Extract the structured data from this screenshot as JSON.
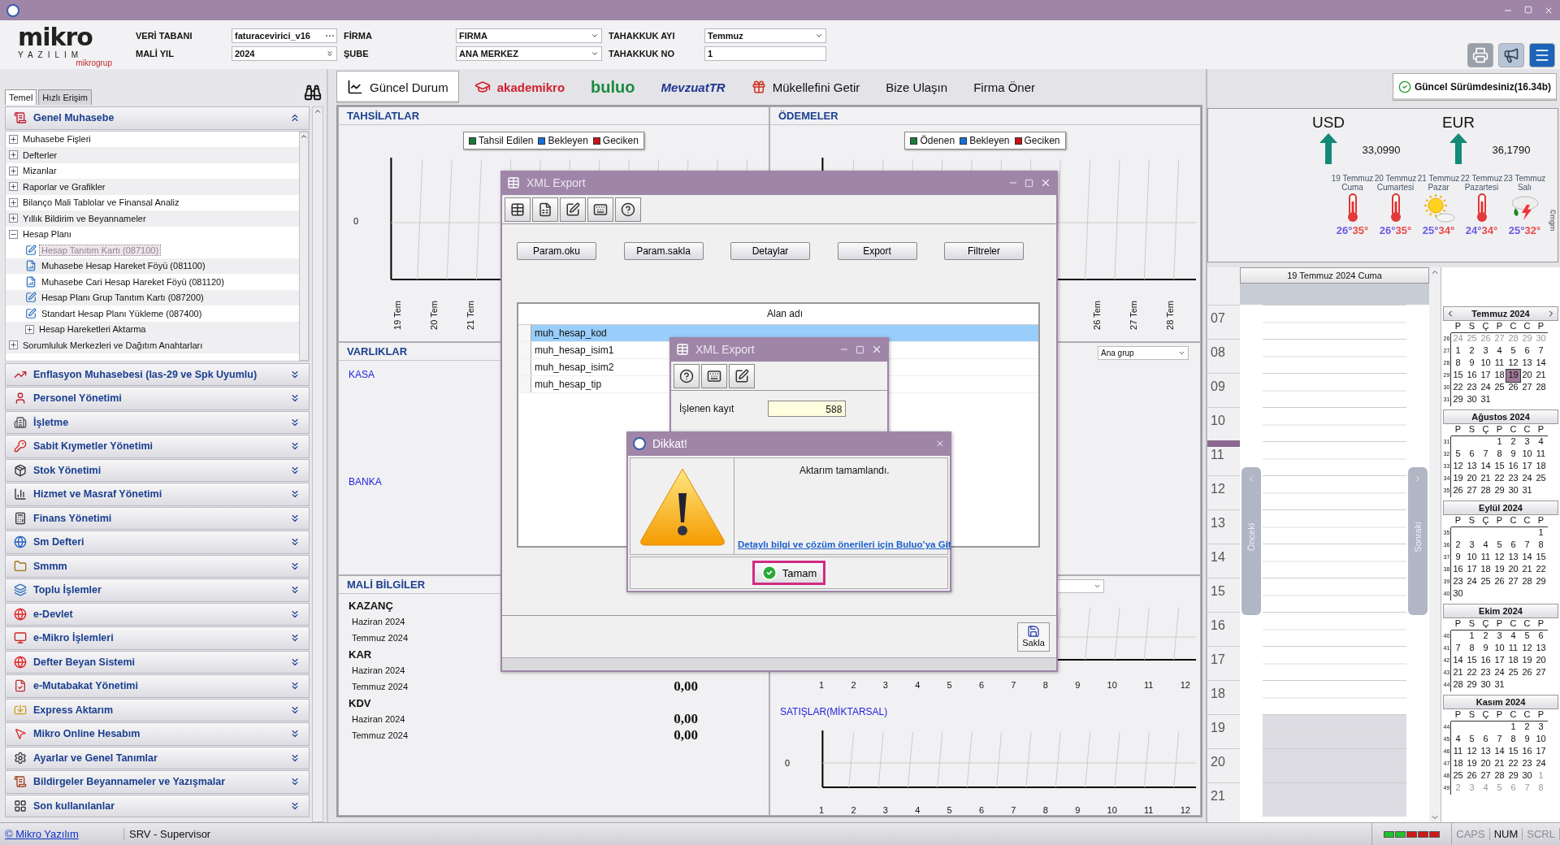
{
  "header": {
    "logo": {
      "name": "mikro",
      "sub": "YAZILIM",
      "group": "mikrogrup"
    },
    "fields": [
      {
        "label": "VERİ TABANI",
        "value": "faturacevirici_v16",
        "kind": "browse"
      },
      {
        "label": "MALİ YIL",
        "value": "2024",
        "kind": "spin"
      },
      {
        "label": "FİRMA",
        "value": "FIRMA",
        "kind": "combo"
      },
      {
        "label": "ŞUBE",
        "value": "ANA MERKEZ",
        "kind": "combo"
      },
      {
        "label": "TAHAKKUK AYI",
        "value": "Temmuz",
        "kind": "combo"
      },
      {
        "label": "TAHAKKUK NO",
        "value": "1",
        "kind": "text"
      }
    ]
  },
  "sidebar": {
    "tabs": [
      {
        "label": "Temel",
        "selected": true
      },
      {
        "label": "Hızlı Erişim",
        "selected": false
      }
    ],
    "open_section": "Genel Muhasebe",
    "tree": [
      {
        "label": "Muhasebe Fişleri",
        "kind": "group",
        "expanded": false,
        "selected": false
      },
      {
        "label": "Defterler",
        "kind": "group",
        "expanded": false,
        "selected": false
      },
      {
        "label": "Mizanlar",
        "kind": "group",
        "expanded": false,
        "selected": false
      },
      {
        "label": "Raporlar ve Grafikler",
        "kind": "group",
        "expanded": false,
        "selected": false
      },
      {
        "label": "Bilanço Mali Tablolar ve Finansal Analiz",
        "kind": "group",
        "expanded": false,
        "selected": false
      },
      {
        "label": "Yıllık Bildirim ve Beyannameler",
        "kind": "group",
        "expanded": false,
        "selected": false
      },
      {
        "label": "Hesap Planı",
        "kind": "group",
        "expanded": true,
        "selected": false,
        "children": [
          {
            "label": "Hesap Tanıtım Kartı (087100)",
            "kind": "form",
            "selected": true
          },
          {
            "label": "Muhasebe Hesap Hareket Föyü (081100)",
            "kind": "report",
            "selected": false
          },
          {
            "label": "Muhasebe Cari Hesap Hareket Föyü (081120)",
            "kind": "report",
            "selected": false
          },
          {
            "label": "Hesap Planı Grup Tanıtım Kartı (087200)",
            "kind": "form",
            "selected": false
          },
          {
            "label": "Standart Hesap Planı Yükleme (087400)",
            "kind": "form",
            "selected": false
          },
          {
            "label": "Hesap Hareketleri Aktarma",
            "kind": "group",
            "expanded": false,
            "selected": false
          }
        ]
      },
      {
        "label": "Sorumluluk Merkezleri ve Dağıtım Anahtarları",
        "kind": "group",
        "expanded": false,
        "selected": false
      }
    ],
    "sections": [
      "Enflasyon Muhasebesi (Ias-29 ve Spk Uyumlu)",
      "Personel Yönetimi",
      "İşletme",
      "Sabit Kıymetler Yönetimi",
      "Stok Yönetimi",
      "Hizmet ve Masraf Yönetimi",
      "Finans Yönetimi",
      "Sm Defteri",
      "Smmm",
      "Toplu İşlemler",
      "e-Devlet",
      "e-Mikro İşlemleri",
      "Defter Beyan Sistemi",
      "e-Mutabakat Yönetimi",
      "Express Aktarım",
      "Mikro Online Hesabım",
      "Ayarlar ve Genel Tanımlar",
      "Bildirgeler Beyannameler ve Yazışmalar",
      "Son kullanılanlar"
    ]
  },
  "tabs": [
    {
      "label": "Güncel Durum",
      "kind": "dashboard",
      "selected": true
    },
    {
      "label": "akademikro",
      "kind": "academy",
      "selected": false
    },
    {
      "label": "buluo",
      "kind": "buluo",
      "selected": false
    },
    {
      "label": "MevzuatTR",
      "kind": "mevzuat",
      "selected": false
    },
    {
      "label": "Mükellefini Getir",
      "kind": "gift",
      "selected": false
    },
    {
      "label": "Bize Ulaşın",
      "kind": "plain",
      "selected": false
    },
    {
      "label": "Firma Öner",
      "kind": "plain",
      "selected": false
    }
  ],
  "version_badge": "Güncel Sürümdesiniz(16.34b)",
  "tahsilatlar": {
    "title": "TAHSİLATLAR",
    "legend": [
      {
        "label": "Tahsil Edilen",
        "color": "#1b7a3a"
      },
      {
        "label": "Bekleyen",
        "color": "#1a6fd6"
      },
      {
        "label": "Geciken",
        "color": "#c81414"
      }
    ],
    "y_tick": "0",
    "x_labels": [
      "19 Tem",
      "20 Tem",
      "21 Tem"
    ]
  },
  "odemeler": {
    "title": "ÖDEMELER",
    "legend": [
      {
        "label": "Ödenen",
        "color": "#1b7a3a"
      },
      {
        "label": "Bekleyen",
        "color": "#1a6fd6"
      },
      {
        "label": "Geciken",
        "color": "#c81414"
      }
    ],
    "x_labels": [
      "26 Tem",
      "27 Tem",
      "28 Tem"
    ]
  },
  "varliklar": {
    "title": "VARLIKLAR",
    "items": [
      "KASA",
      "BANKA"
    ],
    "group_select": "Ana grup"
  },
  "mali_bilgiler": {
    "title": "MALİ BİLGİLER",
    "groups": [
      {
        "name": "KAZANÇ",
        "rows": [
          {
            "period": "Haziran 2024"
          },
          {
            "period": "Temmuz 2024"
          }
        ]
      },
      {
        "name": "KAR",
        "rows": [
          {
            "period": "Haziran 2024"
          },
          {
            "period": "Temmuz 2024",
            "value": "0,00"
          }
        ]
      },
      {
        "name": "KDV",
        "rows": [
          {
            "period": "Haziran 2024",
            "value": "0,00"
          },
          {
            "period": "Temmuz 2024",
            "value": "0,00"
          }
        ]
      }
    ]
  },
  "sales_charts": {
    "months": [
      "1",
      "2",
      "3",
      "4",
      "5",
      "6",
      "7",
      "8",
      "9",
      "10",
      "11",
      "12"
    ],
    "second_months": [
      "1",
      "2",
      "3",
      "4",
      "5",
      "6",
      "7",
      "8",
      "9",
      "10",
      "11",
      "12"
    ],
    "second_title": "SATIŞLAR(MİKTARSAL)",
    "second_y_tick": "0"
  },
  "currencies": [
    {
      "code": "USD",
      "rate": "33,0990"
    },
    {
      "code": "EUR",
      "rate": "36,1790"
    }
  ],
  "weather": {
    "credit": "©mgm",
    "days": [
      {
        "date": "19 Temmuz",
        "day": "Cuma",
        "kind": "hot",
        "low": "26°",
        "high": "35°"
      },
      {
        "date": "20 Temmuz",
        "day": "Cumartesi",
        "kind": "hot",
        "low": "26°",
        "high": "35°"
      },
      {
        "date": "21 Temmuz",
        "day": "Pazar",
        "kind": "sunny",
        "low": "25°",
        "high": "34°"
      },
      {
        "date": "22 Temmuz",
        "day": "Pazartesi",
        "kind": "hot",
        "low": "24°",
        "high": "34°"
      },
      {
        "date": "23 Temmuz",
        "day": "Salı",
        "kind": "storm",
        "low": "25°",
        "high": "32°"
      }
    ]
  },
  "day_view": {
    "title": "19 Temmuz 2024 Cuma",
    "prev": "Önceki",
    "next": "Sonraki",
    "hours": [
      {
        "label": "07",
        "current": false,
        "off_hours": false
      },
      {
        "label": "08",
        "current": false,
        "off_hours": false
      },
      {
        "label": "09",
        "current": false,
        "off_hours": false
      },
      {
        "label": "10",
        "current": false,
        "off_hours": false
      },
      {
        "label": "11",
        "current": true,
        "off_hours": false
      },
      {
        "label": "12",
        "current": false,
        "off_hours": false
      },
      {
        "label": "13",
        "current": false,
        "off_hours": false
      },
      {
        "label": "14",
        "current": false,
        "off_hours": false
      },
      {
        "label": "15",
        "current": false,
        "off_hours": false
      },
      {
        "label": "16",
        "current": false,
        "off_hours": false
      },
      {
        "label": "17",
        "current": false,
        "off_hours": false
      },
      {
        "label": "18",
        "current": false,
        "off_hours": false
      },
      {
        "label": "19",
        "current": false,
        "off_hours": true
      },
      {
        "label": "20",
        "current": false,
        "off_hours": true
      },
      {
        "label": "21",
        "current": false,
        "off_hours": true
      }
    ]
  },
  "calendar": {
    "months": [
      {
        "title": "Temmuz 2024",
        "weekdays": [
          "P",
          "S",
          "Ç",
          "P",
          "C",
          "C",
          "P"
        ],
        "weeks": [
          {
            "no": "26",
            "days": [
              {
                "d": "24",
                "muted": true,
                "selected": false
              },
              {
                "d": "25",
                "muted": true,
                "selected": false
              },
              {
                "d": "26",
                "muted": true,
                "selected": false
              },
              {
                "d": "27",
                "muted": true,
                "selected": false
              },
              {
                "d": "28",
                "muted": true,
                "selected": false
              },
              {
                "d": "29",
                "muted": true,
                "selected": false
              },
              {
                "d": "30",
                "muted": true,
                "selected": false
              }
            ]
          },
          {
            "no": "27",
            "days": [
              {
                "d": "1",
                "muted": false,
                "selected": false
              },
              {
                "d": "2",
                "muted": false,
                "selected": false
              },
              {
                "d": "3",
                "muted": false,
                "selected": false
              },
              {
                "d": "4",
                "muted": false,
                "selected": false
              },
              {
                "d": "5",
                "muted": false,
                "selected": false
              },
              {
                "d": "6",
                "muted": false,
                "selected": false
              },
              {
                "d": "7",
                "muted": false,
                "selected": false
              }
            ]
          },
          {
            "no": "28",
            "days": [
              {
                "d": "8",
                "muted": false,
                "selected": false
              },
              {
                "d": "9",
                "muted": false,
                "selected": false
              },
              {
                "d": "10",
                "muted": false,
                "selected": false
              },
              {
                "d": "11",
                "muted": false,
                "selected": false
              },
              {
                "d": "12",
                "muted": false,
                "selected": false
              },
              {
                "d": "13",
                "muted": false,
                "selected": false
              },
              {
                "d": "14",
                "muted": false,
                "selected": false
              }
            ]
          },
          {
            "no": "29",
            "days": [
              {
                "d": "15",
                "muted": false,
                "selected": false
              },
              {
                "d": "16",
                "muted": false,
                "selected": false
              },
              {
                "d": "17",
                "muted": false,
                "selected": false
              },
              {
                "d": "18",
                "muted": false,
                "selected": false
              },
              {
                "d": "19",
                "muted": false,
                "selected": true
              },
              {
                "d": "20",
                "muted": false,
                "selected": false
              },
              {
                "d": "21",
                "muted": false,
                "selected": false
              }
            ]
          },
          {
            "no": "30",
            "days": [
              {
                "d": "22",
                "muted": false,
                "selected": false
              },
              {
                "d": "23",
                "muted": false,
                "selected": false
              },
              {
                "d": "24",
                "muted": false,
                "selected": false
              },
              {
                "d": "25",
                "muted": false,
                "selected": false
              },
              {
                "d": "26",
                "muted": false,
                "selected": false
              },
              {
                "d": "27",
                "muted": false,
                "selected": false
              },
              {
                "d": "28",
                "muted": false,
                "selected": false
              }
            ]
          },
          {
            "no": "31",
            "days": [
              {
                "d": "29",
                "muted": false,
                "selected": false
              },
              {
                "d": "30",
                "muted": false,
                "selected": false
              },
              {
                "d": "31",
                "muted": false,
                "selected": false
              }
            ]
          }
        ]
      },
      {
        "title": "Ağustos 2024",
        "weekdays": [
          "P",
          "S",
          "Ç",
          "P",
          "C",
          "C",
          "P"
        ],
        "weeks": [
          {
            "no": "31",
            "days": [
              {
                "d": "1",
                "muted": false,
                "selected": false
              },
              {
                "d": "2",
                "muted": false,
                "selected": false
              },
              {
                "d": "3",
                "muted": false,
                "selected": false
              },
              {
                "d": "4",
                "muted": false,
                "selected": false
              }
            ]
          },
          {
            "no": "32",
            "days": [
              {
                "d": "5",
                "muted": false,
                "selected": false
              },
              {
                "d": "6",
                "muted": false,
                "selected": false
              },
              {
                "d": "7",
                "muted": false,
                "selected": false
              },
              {
                "d": "8",
                "muted": false,
                "selected": false
              },
              {
                "d": "9",
                "muted": false,
                "selected": false
              },
              {
                "d": "10",
                "muted": false,
                "selected": false
              },
              {
                "d": "11",
                "muted": false,
                "selected": false
              }
            ]
          },
          {
            "no": "33",
            "days": [
              {
                "d": "12",
                "muted": false,
                "selected": false
              },
              {
                "d": "13",
                "muted": false,
                "selected": false
              },
              {
                "d": "14",
                "muted": false,
                "selected": false
              },
              {
                "d": "15",
                "muted": false,
                "selected": false
              },
              {
                "d": "16",
                "muted": false,
                "selected": false
              },
              {
                "d": "17",
                "muted": false,
                "selected": false
              },
              {
                "d": "18",
                "muted": false,
                "selected": false
              }
            ]
          },
          {
            "no": "34",
            "days": [
              {
                "d": "19",
                "muted": false,
                "selected": false
              },
              {
                "d": "20",
                "muted": false,
                "selected": false
              },
              {
                "d": "21",
                "muted": false,
                "selected": false
              },
              {
                "d": "22",
                "muted": false,
                "selected": false
              },
              {
                "d": "23",
                "muted": false,
                "selected": false
              },
              {
                "d": "24",
                "muted": false,
                "selected": false
              },
              {
                "d": "25",
                "muted": false,
                "selected": false
              }
            ]
          },
          {
            "no": "35",
            "days": [
              {
                "d": "26",
                "muted": false,
                "selected": false
              },
              {
                "d": "27",
                "muted": false,
                "selected": false
              },
              {
                "d": "28",
                "muted": false,
                "selected": false
              },
              {
                "d": "29",
                "muted": false,
                "selected": false
              },
              {
                "d": "30",
                "muted": false,
                "selected": false
              },
              {
                "d": "31",
                "muted": false,
                "selected": false
              }
            ]
          }
        ]
      },
      {
        "title": "Eylül 2024",
        "weekdays": [
          "P",
          "S",
          "Ç",
          "P",
          "C",
          "C",
          "P"
        ],
        "weeks": [
          {
            "no": "35",
            "days": [
              {
                "d": "1",
                "muted": false,
                "selected": false
              }
            ]
          },
          {
            "no": "36",
            "days": [
              {
                "d": "2",
                "muted": false,
                "selected": false
              },
              {
                "d": "3",
                "muted": false,
                "selected": false
              },
              {
                "d": "4",
                "muted": false,
                "selected": false
              },
              {
                "d": "5",
                "muted": false,
                "selected": false
              },
              {
                "d": "6",
                "muted": false,
                "selected": false
              },
              {
                "d": "7",
                "muted": false,
                "selected": false
              },
              {
                "d": "8",
                "muted": false,
                "selected": false
              }
            ]
          },
          {
            "no": "37",
            "days": [
              {
                "d": "9",
                "muted": false,
                "selected": false
              },
              {
                "d": "10",
                "muted": false,
                "selected": false
              },
              {
                "d": "11",
                "muted": false,
                "selected": false
              },
              {
                "d": "12",
                "muted": false,
                "selected": false
              },
              {
                "d": "13",
                "muted": false,
                "selected": false
              },
              {
                "d": "14",
                "muted": false,
                "selected": false
              },
              {
                "d": "15",
                "muted": false,
                "selected": false
              }
            ]
          },
          {
            "no": "38",
            "days": [
              {
                "d": "16",
                "muted": false,
                "selected": false
              },
              {
                "d": "17",
                "muted": false,
                "selected": false
              },
              {
                "d": "18",
                "muted": false,
                "selected": false
              },
              {
                "d": "19",
                "muted": false,
                "selected": false
              },
              {
                "d": "20",
                "muted": false,
                "selected": false
              },
              {
                "d": "21",
                "muted": false,
                "selected": false
              },
              {
                "d": "22",
                "muted": false,
                "selected": false
              }
            ]
          },
          {
            "no": "39",
            "days": [
              {
                "d": "23",
                "muted": false,
                "selected": false
              },
              {
                "d": "24",
                "muted": false,
                "selected": false
              },
              {
                "d": "25",
                "muted": false,
                "selected": false
              },
              {
                "d": "26",
                "muted": false,
                "selected": false
              },
              {
                "d": "27",
                "muted": false,
                "selected": false
              },
              {
                "d": "28",
                "muted": false,
                "selected": false
              },
              {
                "d": "29",
                "muted": false,
                "selected": false
              }
            ]
          },
          {
            "no": "40",
            "days": [
              {
                "d": "30",
                "muted": false,
                "selected": false
              }
            ]
          }
        ]
      },
      {
        "title": "Ekim 2024",
        "weekdays": [
          "P",
          "S",
          "Ç",
          "P",
          "C",
          "C",
          "P"
        ],
        "weeks": [
          {
            "no": "40",
            "days": [
              {
                "d": "1",
                "muted": false,
                "selected": false
              },
              {
                "d": "2",
                "muted": false,
                "selected": false
              },
              {
                "d": "3",
                "muted": false,
                "selected": false
              },
              {
                "d": "4",
                "muted": false,
                "selected": false
              },
              {
                "d": "5",
                "muted": false,
                "selected": false
              },
              {
                "d": "6",
                "muted": false,
                "selected": false
              }
            ]
          },
          {
            "no": "41",
            "days": [
              {
                "d": "7",
                "muted": false,
                "selected": false
              },
              {
                "d": "8",
                "muted": false,
                "selected": false
              },
              {
                "d": "9",
                "muted": false,
                "selected": false
              },
              {
                "d": "10",
                "muted": false,
                "selected": false
              },
              {
                "d": "11",
                "muted": false,
                "selected": false
              },
              {
                "d": "12",
                "muted": false,
                "selected": false
              },
              {
                "d": "13",
                "muted": false,
                "selected": false
              }
            ]
          },
          {
            "no": "42",
            "days": [
              {
                "d": "14",
                "muted": false,
                "selected": false
              },
              {
                "d": "15",
                "muted": false,
                "selected": false
              },
              {
                "d": "16",
                "muted": false,
                "selected": false
              },
              {
                "d": "17",
                "muted": false,
                "selected": false
              },
              {
                "d": "18",
                "muted": false,
                "selected": false
              },
              {
                "d": "19",
                "muted": false,
                "selected": false
              },
              {
                "d": "20",
                "muted": false,
                "selected": false
              }
            ]
          },
          {
            "no": "43",
            "days": [
              {
                "d": "21",
                "muted": false,
                "selected": false
              },
              {
                "d": "22",
                "muted": false,
                "selected": false
              },
              {
                "d": "23",
                "muted": false,
                "selected": false
              },
              {
                "d": "24",
                "muted": false,
                "selected": false
              },
              {
                "d": "25",
                "muted": false,
                "selected": false
              },
              {
                "d": "26",
                "muted": false,
                "selected": false
              },
              {
                "d": "27",
                "muted": false,
                "selected": false
              }
            ]
          },
          {
            "no": "44",
            "days": [
              {
                "d": "28",
                "muted": false,
                "selected": false
              },
              {
                "d": "29",
                "muted": false,
                "selected": false
              },
              {
                "d": "30",
                "muted": false,
                "selected": false
              },
              {
                "d": "31",
                "muted": false,
                "selected": false
              }
            ]
          }
        ]
      },
      {
        "title": "Kasım 2024",
        "weekdays": [
          "P",
          "S",
          "Ç",
          "P",
          "C",
          "C",
          "P"
        ],
        "weeks": [
          {
            "no": "44",
            "days": [
              {
                "d": "1",
                "muted": false,
                "selected": false
              },
              {
                "d": "2",
                "muted": false,
                "selected": false
              },
              {
                "d": "3",
                "muted": false,
                "selected": false
              }
            ]
          },
          {
            "no": "45",
            "days": [
              {
                "d": "4",
                "muted": false,
                "selected": false
              },
              {
                "d": "5",
                "muted": false,
                "selected": false
              },
              {
                "d": "6",
                "muted": false,
                "selected": false
              },
              {
                "d": "7",
                "muted": false,
                "selected": false
              },
              {
                "d": "8",
                "muted": false,
                "selected": false
              },
              {
                "d": "9",
                "muted": false,
                "selected": false
              },
              {
                "d": "10",
                "muted": false,
                "selected": false
              }
            ]
          },
          {
            "no": "46",
            "days": [
              {
                "d": "11",
                "muted": false,
                "selected": false
              },
              {
                "d": "12",
                "muted": false,
                "selected": false
              },
              {
                "d": "13",
                "muted": false,
                "selected": false
              },
              {
                "d": "14",
                "muted": false,
                "selected": false
              },
              {
                "d": "15",
                "muted": false,
                "selected": false
              },
              {
                "d": "16",
                "muted": false,
                "selected": false
              },
              {
                "d": "17",
                "muted": false,
                "selected": false
              }
            ]
          },
          {
            "no": "47",
            "days": [
              {
                "d": "18",
                "muted": false,
                "selected": false
              },
              {
                "d": "19",
                "muted": false,
                "selected": false
              },
              {
                "d": "20",
                "muted": false,
                "selected": false
              },
              {
                "d": "21",
                "muted": false,
                "selected": false
              },
              {
                "d": "22",
                "muted": false,
                "selected": false
              },
              {
                "d": "23",
                "muted": false,
                "selected": false
              },
              {
                "d": "24",
                "muted": false,
                "selected": false
              }
            ]
          },
          {
            "no": "48",
            "days": [
              {
                "d": "25",
                "muted": false,
                "selected": false
              },
              {
                "d": "26",
                "muted": false,
                "selected": false
              },
              {
                "d": "27",
                "muted": false,
                "selected": false
              },
              {
                "d": "28",
                "muted": false,
                "selected": false
              },
              {
                "d": "29",
                "muted": false,
                "selected": false
              },
              {
                "d": "30",
                "muted": false,
                "selected": false
              },
              {
                "d": "1",
                "muted": true,
                "selected": false
              }
            ]
          },
          {
            "no": "49",
            "days": [
              {
                "d": "2",
                "muted": true,
                "selected": false
              },
              {
                "d": "3",
                "muted": true,
                "selected": false
              },
              {
                "d": "4",
                "muted": true,
                "selected": false
              },
              {
                "d": "5",
                "muted": true,
                "selected": false
              },
              {
                "d": "6",
                "muted": true,
                "selected": false
              },
              {
                "d": "7",
                "muted": true,
                "selected": false
              },
              {
                "d": "8",
                "muted": true,
                "selected": false
              }
            ]
          }
        ]
      }
    ]
  },
  "export_window": {
    "title": "XML Export",
    "buttons": [
      "Param.oku",
      "Param.sakla",
      "Detaylar",
      "Export",
      "Filtreler"
    ],
    "grid": {
      "column": "Alan adı",
      "rows": [
        {
          "value": "muh_hesap_kod",
          "selected": true
        },
        {
          "value": "muh_hesap_isim1",
          "selected": false
        },
        {
          "value": "muh_hesap_isim2",
          "selected": false
        },
        {
          "value": "muh_hesap_tip",
          "selected": false
        }
      ]
    },
    "save": "Sakla"
  },
  "progress_window": {
    "title": "XML Export",
    "label": "İşlenen kayıt",
    "value": "588"
  },
  "alert": {
    "title": "Dikkat!",
    "message": "Aktarım tamamlandı.",
    "link": "Detaylı bilgi ve çözüm önerileri için Buluo’ya Git",
    "button": "Tamam"
  },
  "status_bar": {
    "link": "© Mikro Yazılım",
    "user": "SRV - Supervisor",
    "leds": [
      {
        "color": "#22c02a"
      },
      {
        "color": "#22c02a"
      },
      {
        "color": "#d01818"
      },
      {
        "color": "#d01818"
      },
      {
        "color": "#d01818"
      }
    ],
    "keys": [
      {
        "label": "CAPS",
        "on": false
      },
      {
        "label": "NUM",
        "on": true
      },
      {
        "label": "SCRL",
        "on": false
      }
    ]
  }
}
